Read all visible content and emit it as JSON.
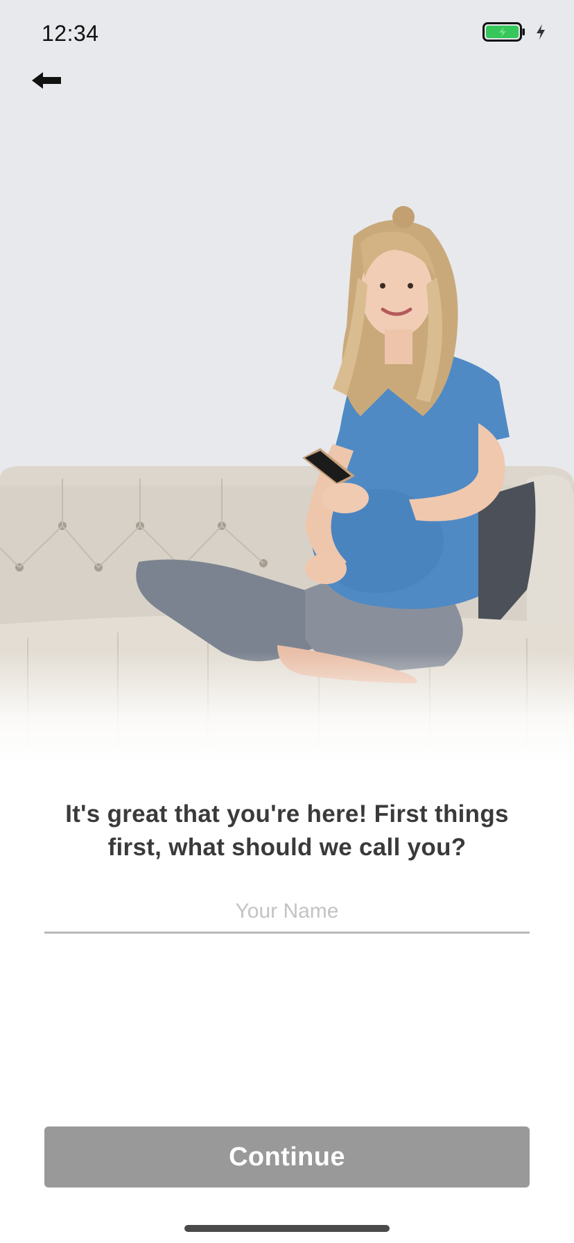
{
  "status_bar": {
    "time": "12:34",
    "battery_icon": "battery-charging-icon",
    "battery_color": "#35c759"
  },
  "nav": {
    "back_icon": "arrow-left-icon"
  },
  "hero": {
    "image": "pregnant-woman-on-sofa-photo"
  },
  "onboarding": {
    "prompt": "It's great that you're here! First things first, what should we call you?",
    "name_field": {
      "placeholder": "Your Name",
      "value": ""
    },
    "continue_label": "Continue",
    "continue_color": "#999999"
  }
}
